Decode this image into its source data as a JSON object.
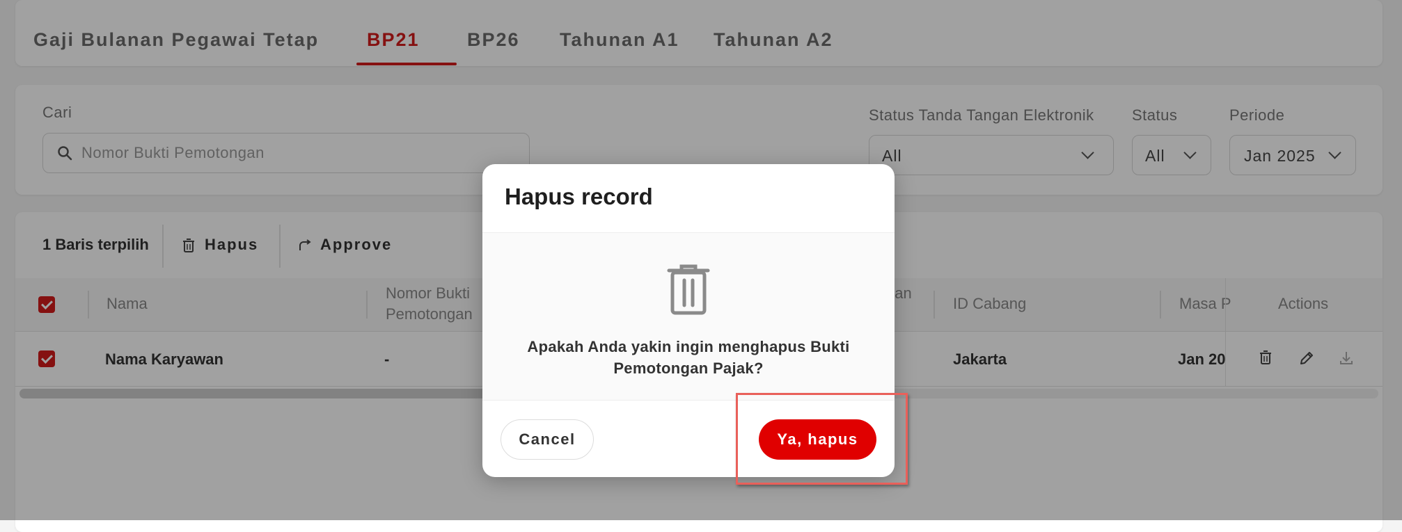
{
  "tabs": [
    {
      "label": "Gaji Bulanan Pegawai Tetap",
      "active": false
    },
    {
      "label": "BP21",
      "active": true
    },
    {
      "label": "BP26",
      "active": false
    },
    {
      "label": "Tahunan A1",
      "active": false
    },
    {
      "label": "Tahunan A2",
      "active": false
    }
  ],
  "filters": {
    "search_label": "Cari",
    "search_placeholder": "Nomor Bukti Pemotongan",
    "tte_label": "Status Tanda Tangan Elektronik",
    "tte_value": "All",
    "status_label": "Status",
    "status_value": "All",
    "periode_label": "Periode",
    "periode_value": "Jan 2025"
  },
  "toolbar": {
    "selected_text": "1 Baris terpilih",
    "delete_label": "Hapus",
    "approve_label": "Approve"
  },
  "table": {
    "columns": {
      "nama": "Nama",
      "nomor_line1": "Nomor Bukti",
      "nomor_line2": "Pemotongan",
      "partial": "gan",
      "id_cabang": "ID Cabang",
      "masa": "Masa P",
      "actions": "Actions"
    },
    "rows": [
      {
        "nama": "Nama Karyawan",
        "nomor": "-",
        "id_cabang": "Jakarta",
        "masa": "Jan 20"
      }
    ]
  },
  "modal": {
    "title": "Hapus record",
    "message": "Apakah Anda yakin ingin menghapus Bukti Pemotongan Pajak?",
    "cancel_label": "Cancel",
    "confirm_label": "Ya, hapus"
  },
  "colors": {
    "accent": "#d31b1b",
    "confirm": "#e00000",
    "highlight": "#e9605a"
  },
  "icons": {
    "search": "search-icon",
    "trash": "trash-icon",
    "approve": "approve-arrow-icon",
    "edit": "pencil-icon",
    "download": "download-icon"
  }
}
